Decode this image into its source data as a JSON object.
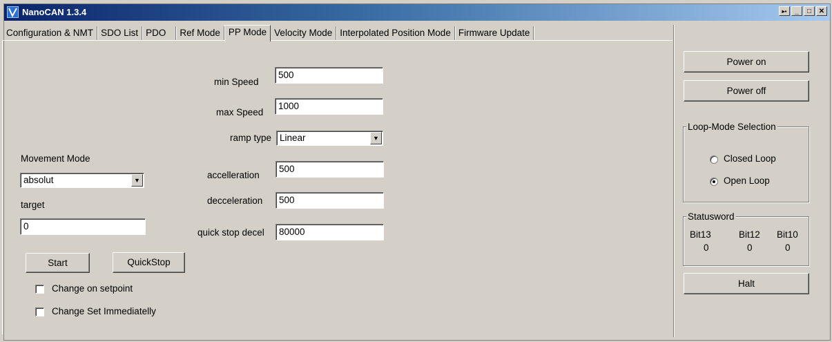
{
  "window": {
    "title": "NanoCAN 1.3.4"
  },
  "titlebar_buttons": {
    "restore": "▸▪",
    "minimize": "_",
    "maximize": "□",
    "close": "✕"
  },
  "tabs": [
    {
      "label": "Configuration & NMT"
    },
    {
      "label": "SDO List"
    },
    {
      "label": "PDO"
    },
    {
      "label": "Ref Mode"
    },
    {
      "label": "PP Mode",
      "active": true
    },
    {
      "label": "Velocity Mode"
    },
    {
      "label": "Interpolated Position Mode"
    },
    {
      "label": "Firmware Update"
    }
  ],
  "params": {
    "min_speed": {
      "label": "min Speed",
      "value": "500"
    },
    "max_speed": {
      "label": "max Speed",
      "value": "1000"
    },
    "ramp_type": {
      "label": "ramp type",
      "value": "Linear"
    },
    "accel": {
      "label": "accelleration",
      "value": "500"
    },
    "decel": {
      "label": "decceleration",
      "value": "500"
    },
    "quick_stop": {
      "label": "quick stop decel",
      "value": "80000"
    }
  },
  "movement": {
    "mode_label": "Movement Mode",
    "mode_value": "absolut",
    "target_label": "target",
    "target_value": "0",
    "start_label": "Start",
    "quickstop_label": "QuickStop",
    "change_setpoint_label": "Change on setpoint",
    "change_immediately_label": "Change Set Immediatelly"
  },
  "side": {
    "power_on": "Power on",
    "power_off": "Power off",
    "loop_title": "Loop-Mode Selection",
    "closed_loop": "Closed Loop",
    "open_loop": "Open Loop",
    "status_title": "Statusword",
    "bits": [
      {
        "name": "Bit13",
        "value": "0"
      },
      {
        "name": "Bit12",
        "value": "0"
      },
      {
        "name": "Bit10",
        "value": "0"
      }
    ],
    "halt": "Halt"
  }
}
